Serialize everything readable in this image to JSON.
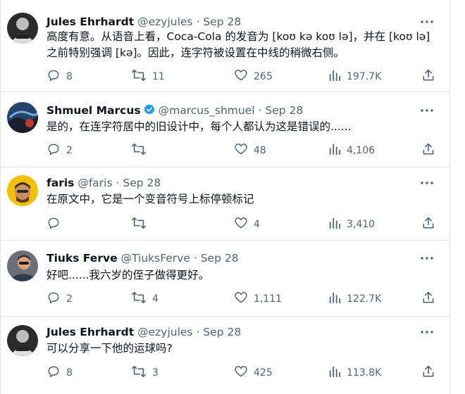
{
  "tweets": [
    {
      "name": "Jules Ehrhardt",
      "handle": "@ezyjules",
      "sep": "·",
      "date": "Sep 28",
      "verified": false,
      "text_lines": [
        "高度有意。从语音上看，Coca-Cola 的发音为 [koʊ kə koʊ lə]，并在 [koʊ lə]",
        "之前特别强调 [kə]。因此，连字符被设置在中线的稍微右侧。"
      ],
      "replies": "8",
      "retweets": "11",
      "likes": "265",
      "views": "197.7K"
    },
    {
      "name": "Shmuel Marcus",
      "handle": "@marcus_shmuel",
      "sep": "·",
      "date": "Sep 28",
      "verified": true,
      "text_lines": [
        "是的，在连字符居中的旧设计中，每个人都认为这是错误的......"
      ],
      "replies": "2",
      "retweets": "",
      "likes": "48",
      "views": "4,106"
    },
    {
      "name": "faris",
      "handle": "@faris",
      "sep": "·",
      "date": "Sep 28",
      "verified": false,
      "text_lines": [
        "在原文中，它是一个变音符号上标停顿标记"
      ],
      "replies": "",
      "retweets": "",
      "likes": "4",
      "views": "3,410"
    },
    {
      "name": "Tiuks Ferve",
      "handle": "@TiuksFerve",
      "sep": "·",
      "date": "Sep 28",
      "verified": false,
      "text_lines": [
        "好吧......我六岁的侄子做得更好。"
      ],
      "replies": "2",
      "retweets": "4",
      "likes": "1,111",
      "views": "122.7K"
    },
    {
      "name": "Jules Ehrhardt",
      "handle": "@ezyjules",
      "sep": "·",
      "date": "Sep 28",
      "verified": false,
      "text_lines": [
        "可以分享一下他的运球吗?"
      ],
      "replies": "8",
      "retweets": "3",
      "likes": "425",
      "views": "113.8K"
    }
  ],
  "colors": {
    "text_primary": "#0f1419",
    "text_secondary": "#536471",
    "verified": "#1d9bf0",
    "divider": "#e4e7ea"
  },
  "icons": [
    "reply-icon",
    "retweet-icon",
    "like-icon",
    "views-icon",
    "share-icon",
    "more-icon",
    "verified-badge-icon"
  ]
}
